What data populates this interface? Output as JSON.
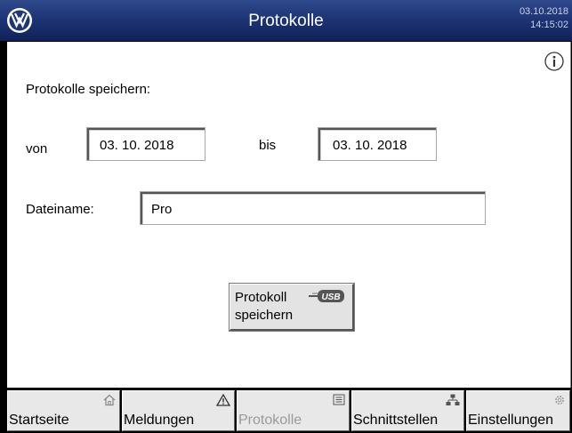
{
  "header": {
    "title": "Protokolle",
    "date": "03.10.2018",
    "time": "14:15:02",
    "logo_icon": "vw-logo-icon"
  },
  "form": {
    "section_label": "Protokolle speichern:",
    "from_label": "von",
    "from_value": "03. 10. 2018",
    "to_label": "bis",
    "to_value": "03. 10. 2018",
    "filename_label": "Dateiname:",
    "filename_value": "Pro"
  },
  "save_button": {
    "line1": "Protokoll",
    "line2": "speichern",
    "icon": "usb-icon"
  },
  "tabs": [
    {
      "label": "Startseite",
      "icon": "home-icon",
      "enabled": true
    },
    {
      "label": "Meldungen",
      "icon": "warning-icon",
      "enabled": true
    },
    {
      "label": "Protokolle",
      "icon": "list-icon",
      "enabled": false
    },
    {
      "label": "Schnittstellen",
      "icon": "network-icon",
      "enabled": true
    },
    {
      "label": "Einstellungen",
      "icon": "gear-icon",
      "enabled": true
    }
  ],
  "colors": {
    "header": "#1e3576",
    "content": "#ffffff",
    "button": "#e3e3e3"
  }
}
